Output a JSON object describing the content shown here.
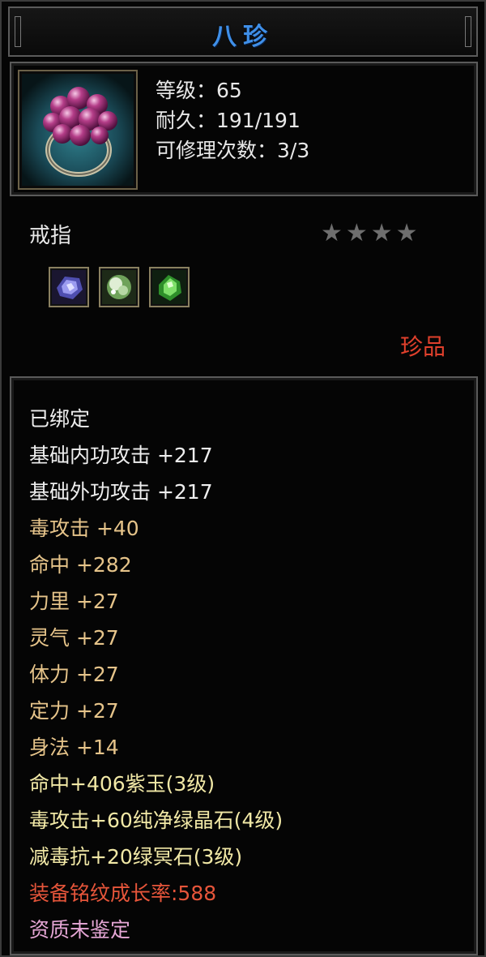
{
  "title": "八珍",
  "item": {
    "level_text": "等级：65",
    "durability_text": "耐久：191/191",
    "repair_text": "可修理次数：3/3",
    "type": "戒指",
    "stars": "★★★★",
    "quality": "珍品"
  },
  "gems": [
    "purple-gem-icon",
    "white-green-gem-icon",
    "green-gem-icon"
  ],
  "attributes": [
    {
      "text": "已绑定",
      "color": "#eeeeee"
    },
    {
      "text": "基础内功攻击  +217",
      "color": "#eeeeee"
    },
    {
      "text": "基础外功攻击  +217",
      "color": "#eeeeee"
    },
    {
      "text": "毒攻击  +40",
      "color": "#e6c48a"
    },
    {
      "text": "命中  +282",
      "color": "#e6c48a"
    },
    {
      "text": "力里  +27",
      "color": "#e6c48a"
    },
    {
      "text": "灵气  +27",
      "color": "#e6c48a"
    },
    {
      "text": "体力  +27",
      "color": "#e6c48a"
    },
    {
      "text": "定力  +27",
      "color": "#e6c48a"
    },
    {
      "text": "身法  +14",
      "color": "#e6c48a"
    },
    {
      "text": "命中+406紫玉(3级)",
      "color": "#f1e8a6"
    },
    {
      "text": "毒攻击+60纯净绿晶石(4级)",
      "color": "#f1e8a6"
    },
    {
      "text": "减毒抗+20绿冥石(3级)",
      "color": "#f1e8a6"
    },
    {
      "text": "装备铭纹成长率:588",
      "color": "#e6553a"
    },
    {
      "text": "资质未鉴定",
      "color": "#e6a7d6"
    }
  ]
}
